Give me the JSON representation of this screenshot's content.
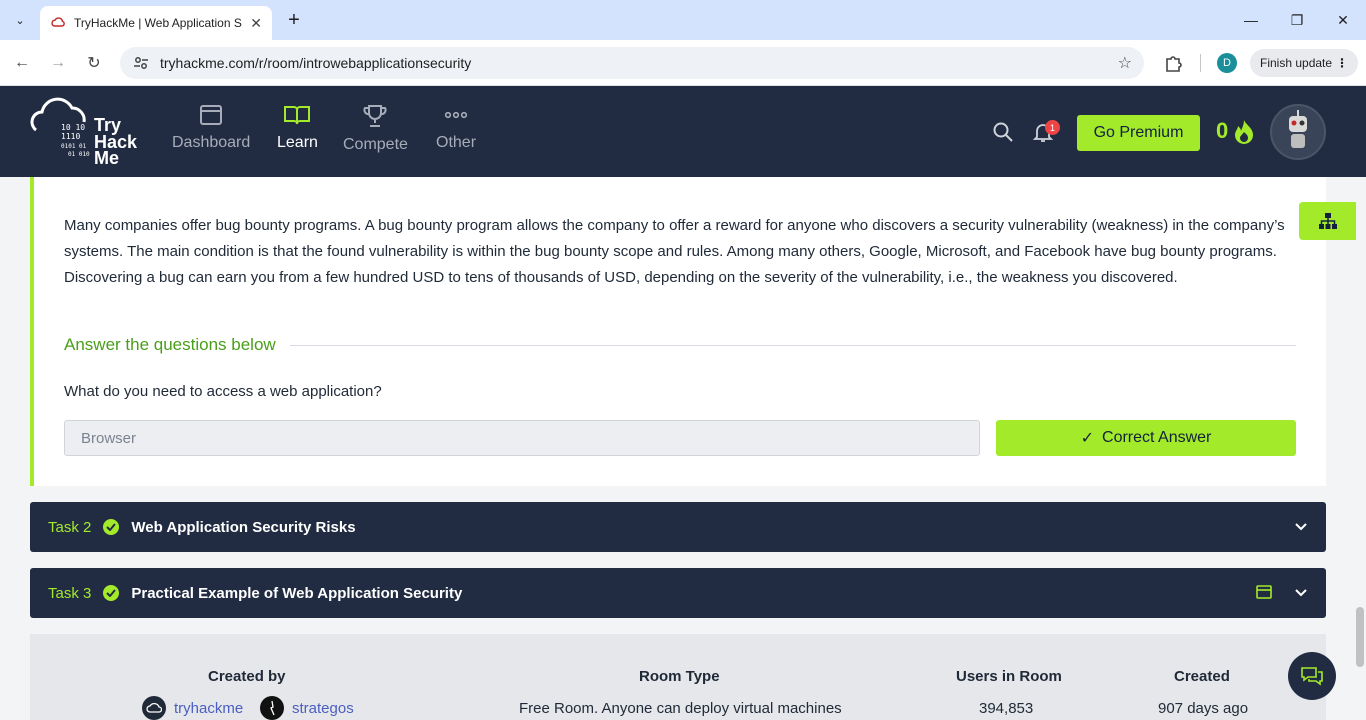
{
  "browser": {
    "tab_title": "TryHackMe | Web Application S",
    "url": "tryhackme.com/r/room/introwebapplicationsecurity",
    "profile_initial": "D",
    "finish_update": "Finish update"
  },
  "header": {
    "logo_text_1": "Try",
    "logo_text_2": "Hack",
    "logo_text_3": "Me",
    "nav": [
      {
        "label": "Dashboard"
      },
      {
        "label": "Learn"
      },
      {
        "label": "Compete"
      },
      {
        "label": "Other"
      }
    ],
    "notification_count": "1",
    "premium_label": "Go Premium",
    "streak_count": "0"
  },
  "task1": {
    "text": "Many companies offer bug bounty programs. A bug bounty program allows the company to offer a reward for anyone who discovers a security vulnerability (weakness) in the company’s systems. The main condition is that the found vulnerability is within the bug bounty scope and rules. Among many others, Google, Microsoft, and Facebook have bug bounty programs. Discovering a bug can earn you from a few hundred USD to tens of thousands of USD, depending on the severity of the vulnerability, i.e., the weakness you discovered.",
    "answer_heading": "Answer the questions below",
    "question": "What do you need to access a web application?",
    "answer_value": "Browser",
    "correct_label": "Correct Answer"
  },
  "tasks": [
    {
      "num": "Task 2",
      "title": "Web Application Security Risks"
    },
    {
      "num": "Task 3",
      "title": "Practical Example of Web Application Security"
    }
  ],
  "room_info": {
    "created_by_label": "Created by",
    "creators": [
      "tryhackme",
      "strategos"
    ],
    "room_type_label": "Room Type",
    "room_type_value": "Free Room. Anyone can deploy virtual machines",
    "users_label": "Users in Room",
    "users_value": "394,853",
    "created_label": "Created",
    "created_value": "907 days ago"
  },
  "colors": {
    "accent": "#a3ea2a",
    "navy": "#212c42"
  }
}
